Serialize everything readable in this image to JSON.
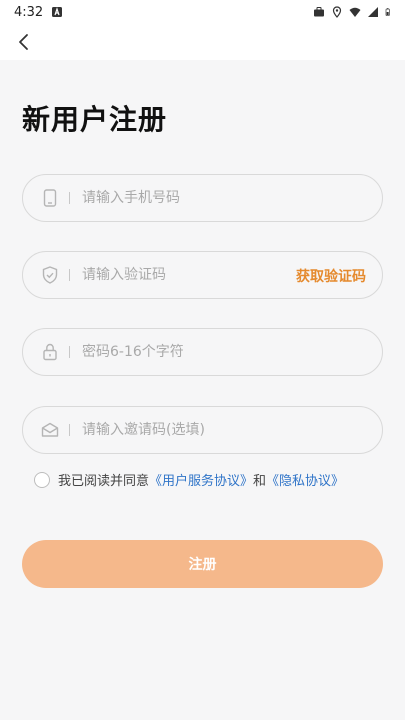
{
  "status_bar": {
    "time": "4:32",
    "icons": [
      "notification-a-icon",
      "briefcase-icon",
      "location-icon",
      "wifi-icon",
      "signal-icon",
      "battery-icon"
    ]
  },
  "header": {
    "back_icon": "chevron-left-icon"
  },
  "title": "新用户注册",
  "fields": {
    "phone": {
      "placeholder": "请输入手机号码",
      "value": "",
      "icon": "phone-icon"
    },
    "code": {
      "placeholder": "请输入验证码",
      "value": "",
      "icon": "shield-icon",
      "action_label": "获取验证码"
    },
    "password": {
      "placeholder": "密码6-16个字符",
      "value": "",
      "icon": "lock-icon"
    },
    "invite": {
      "placeholder": "请输入邀请码(选填)",
      "value": "",
      "icon": "mail-icon"
    }
  },
  "agreement": {
    "checked": false,
    "prefix": "我已阅读并同意",
    "user_agreement": "《用户服务协议》",
    "and": "和",
    "privacy_policy": "《隐私协议》"
  },
  "register_label": "注册",
  "colors": {
    "accent": "#e58a2e",
    "button_bg": "#f5b88b",
    "link": "#2f74c8",
    "page_bg": "#f6f6f7"
  }
}
